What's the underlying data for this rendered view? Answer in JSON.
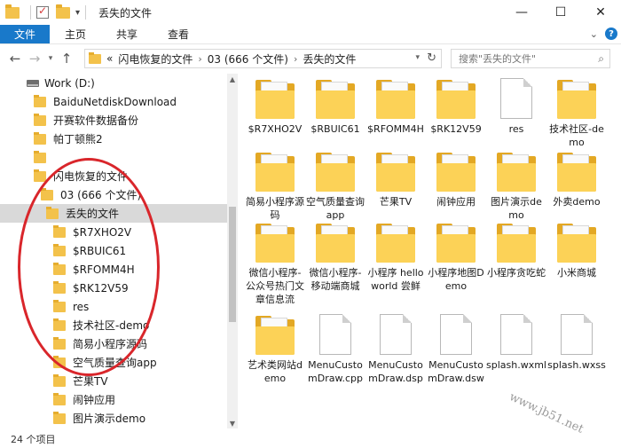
{
  "window": {
    "title": "丢失的文件",
    "minimize_glyph": "—",
    "maximize_glyph": "☐",
    "close_glyph": "✕"
  },
  "ribbon": {
    "tabs": [
      "文件",
      "主页",
      "共享",
      "查看"
    ],
    "help_glyph": "?"
  },
  "address": {
    "back_glyph": "←",
    "forward_glyph": "→",
    "recent_glyph": "▾",
    "up_glyph": "↑",
    "overflow": "«",
    "crumbs": [
      "闪电恢复的文件",
      "03 (666 个文件)",
      "丢失的文件"
    ],
    "crumb_sep": "›",
    "refresh_glyph": "↻",
    "search_placeholder": "搜索\"丢失的文件\"",
    "search_glyph": "⌕"
  },
  "nav_pane": {
    "items": [
      {
        "label": "Work (D:)",
        "icon": "drive-icon"
      },
      {
        "label": "BaiduNetdiskDownload",
        "icon": "folder-icon"
      },
      {
        "label": "开赛软件数据备份",
        "icon": "folder-icon"
      },
      {
        "label": "帕丁顿熊2",
        "icon": "folder-icon"
      },
      {
        "label": "",
        "icon": "folder-icon"
      },
      {
        "label": "闪电恢复的文件",
        "icon": "folder-icon"
      },
      {
        "label": "03 (666 个文件)",
        "icon": "folder-icon"
      },
      {
        "label": "丢失的文件",
        "icon": "folder-icon",
        "selected": true
      },
      {
        "label": "$R7XHO2V",
        "icon": "folder-icon"
      },
      {
        "label": "$RBUIC61",
        "icon": "folder-icon"
      },
      {
        "label": "$RFOMM4H",
        "icon": "folder-icon"
      },
      {
        "label": "$RK12V59",
        "icon": "folder-icon"
      },
      {
        "label": "res",
        "icon": "folder-icon"
      },
      {
        "label": "技术社区-demo",
        "icon": "folder-icon"
      },
      {
        "label": "简易小程序源码",
        "icon": "folder-icon"
      },
      {
        "label": "空气质量查询app",
        "icon": "folder-icon"
      },
      {
        "label": "芒果TV",
        "icon": "folder-icon"
      },
      {
        "label": "闹钟应用",
        "icon": "folder-icon"
      },
      {
        "label": "图片演示demo",
        "icon": "folder-icon"
      }
    ]
  },
  "files": [
    {
      "name": "$R7XHO2V",
      "type": "folder"
    },
    {
      "name": "$RBUIC61",
      "type": "folder"
    },
    {
      "name": "$RFOMM4H",
      "type": "folder"
    },
    {
      "name": "$RK12V59",
      "type": "folder"
    },
    {
      "name": "res",
      "type": "file"
    },
    {
      "name": "技术社区-demo",
      "type": "folder"
    },
    {
      "name": "简易小程序源码",
      "type": "folder"
    },
    {
      "name": "空气质量查询app",
      "type": "folder"
    },
    {
      "name": "芒果TV",
      "type": "folder"
    },
    {
      "name": "闹钟应用",
      "type": "folder"
    },
    {
      "name": "图片演示demo",
      "type": "folder"
    },
    {
      "name": "外卖demo",
      "type": "folder"
    },
    {
      "name": "微信小程序-公众号热门文章信息流",
      "type": "folder"
    },
    {
      "name": "微信小程序-移动端商城",
      "type": "folder"
    },
    {
      "name": "小程序 hello world 尝鲜",
      "type": "folder"
    },
    {
      "name": "小程序地图Demo",
      "type": "folder"
    },
    {
      "name": "小程序贪吃蛇",
      "type": "folder"
    },
    {
      "name": "小米商城",
      "type": "folder"
    },
    {
      "name": "艺术类网站demo",
      "type": "folder"
    },
    {
      "name": "MenuCustomDraw.cpp",
      "type": "file"
    },
    {
      "name": "MenuCustomDraw.dsp",
      "type": "file"
    },
    {
      "name": "MenuCustomDraw.dsw",
      "type": "file"
    },
    {
      "name": "splash.wxml",
      "type": "file"
    },
    {
      "name": "splash.wxss",
      "type": "file"
    }
  ],
  "status": {
    "item_count": "24 个项目"
  },
  "watermark": "www.jb51.net",
  "colors": {
    "accent": "#1979ca",
    "selection": "#d9d9d9",
    "annotation": "#d9262b",
    "folder": "#fcd257"
  }
}
